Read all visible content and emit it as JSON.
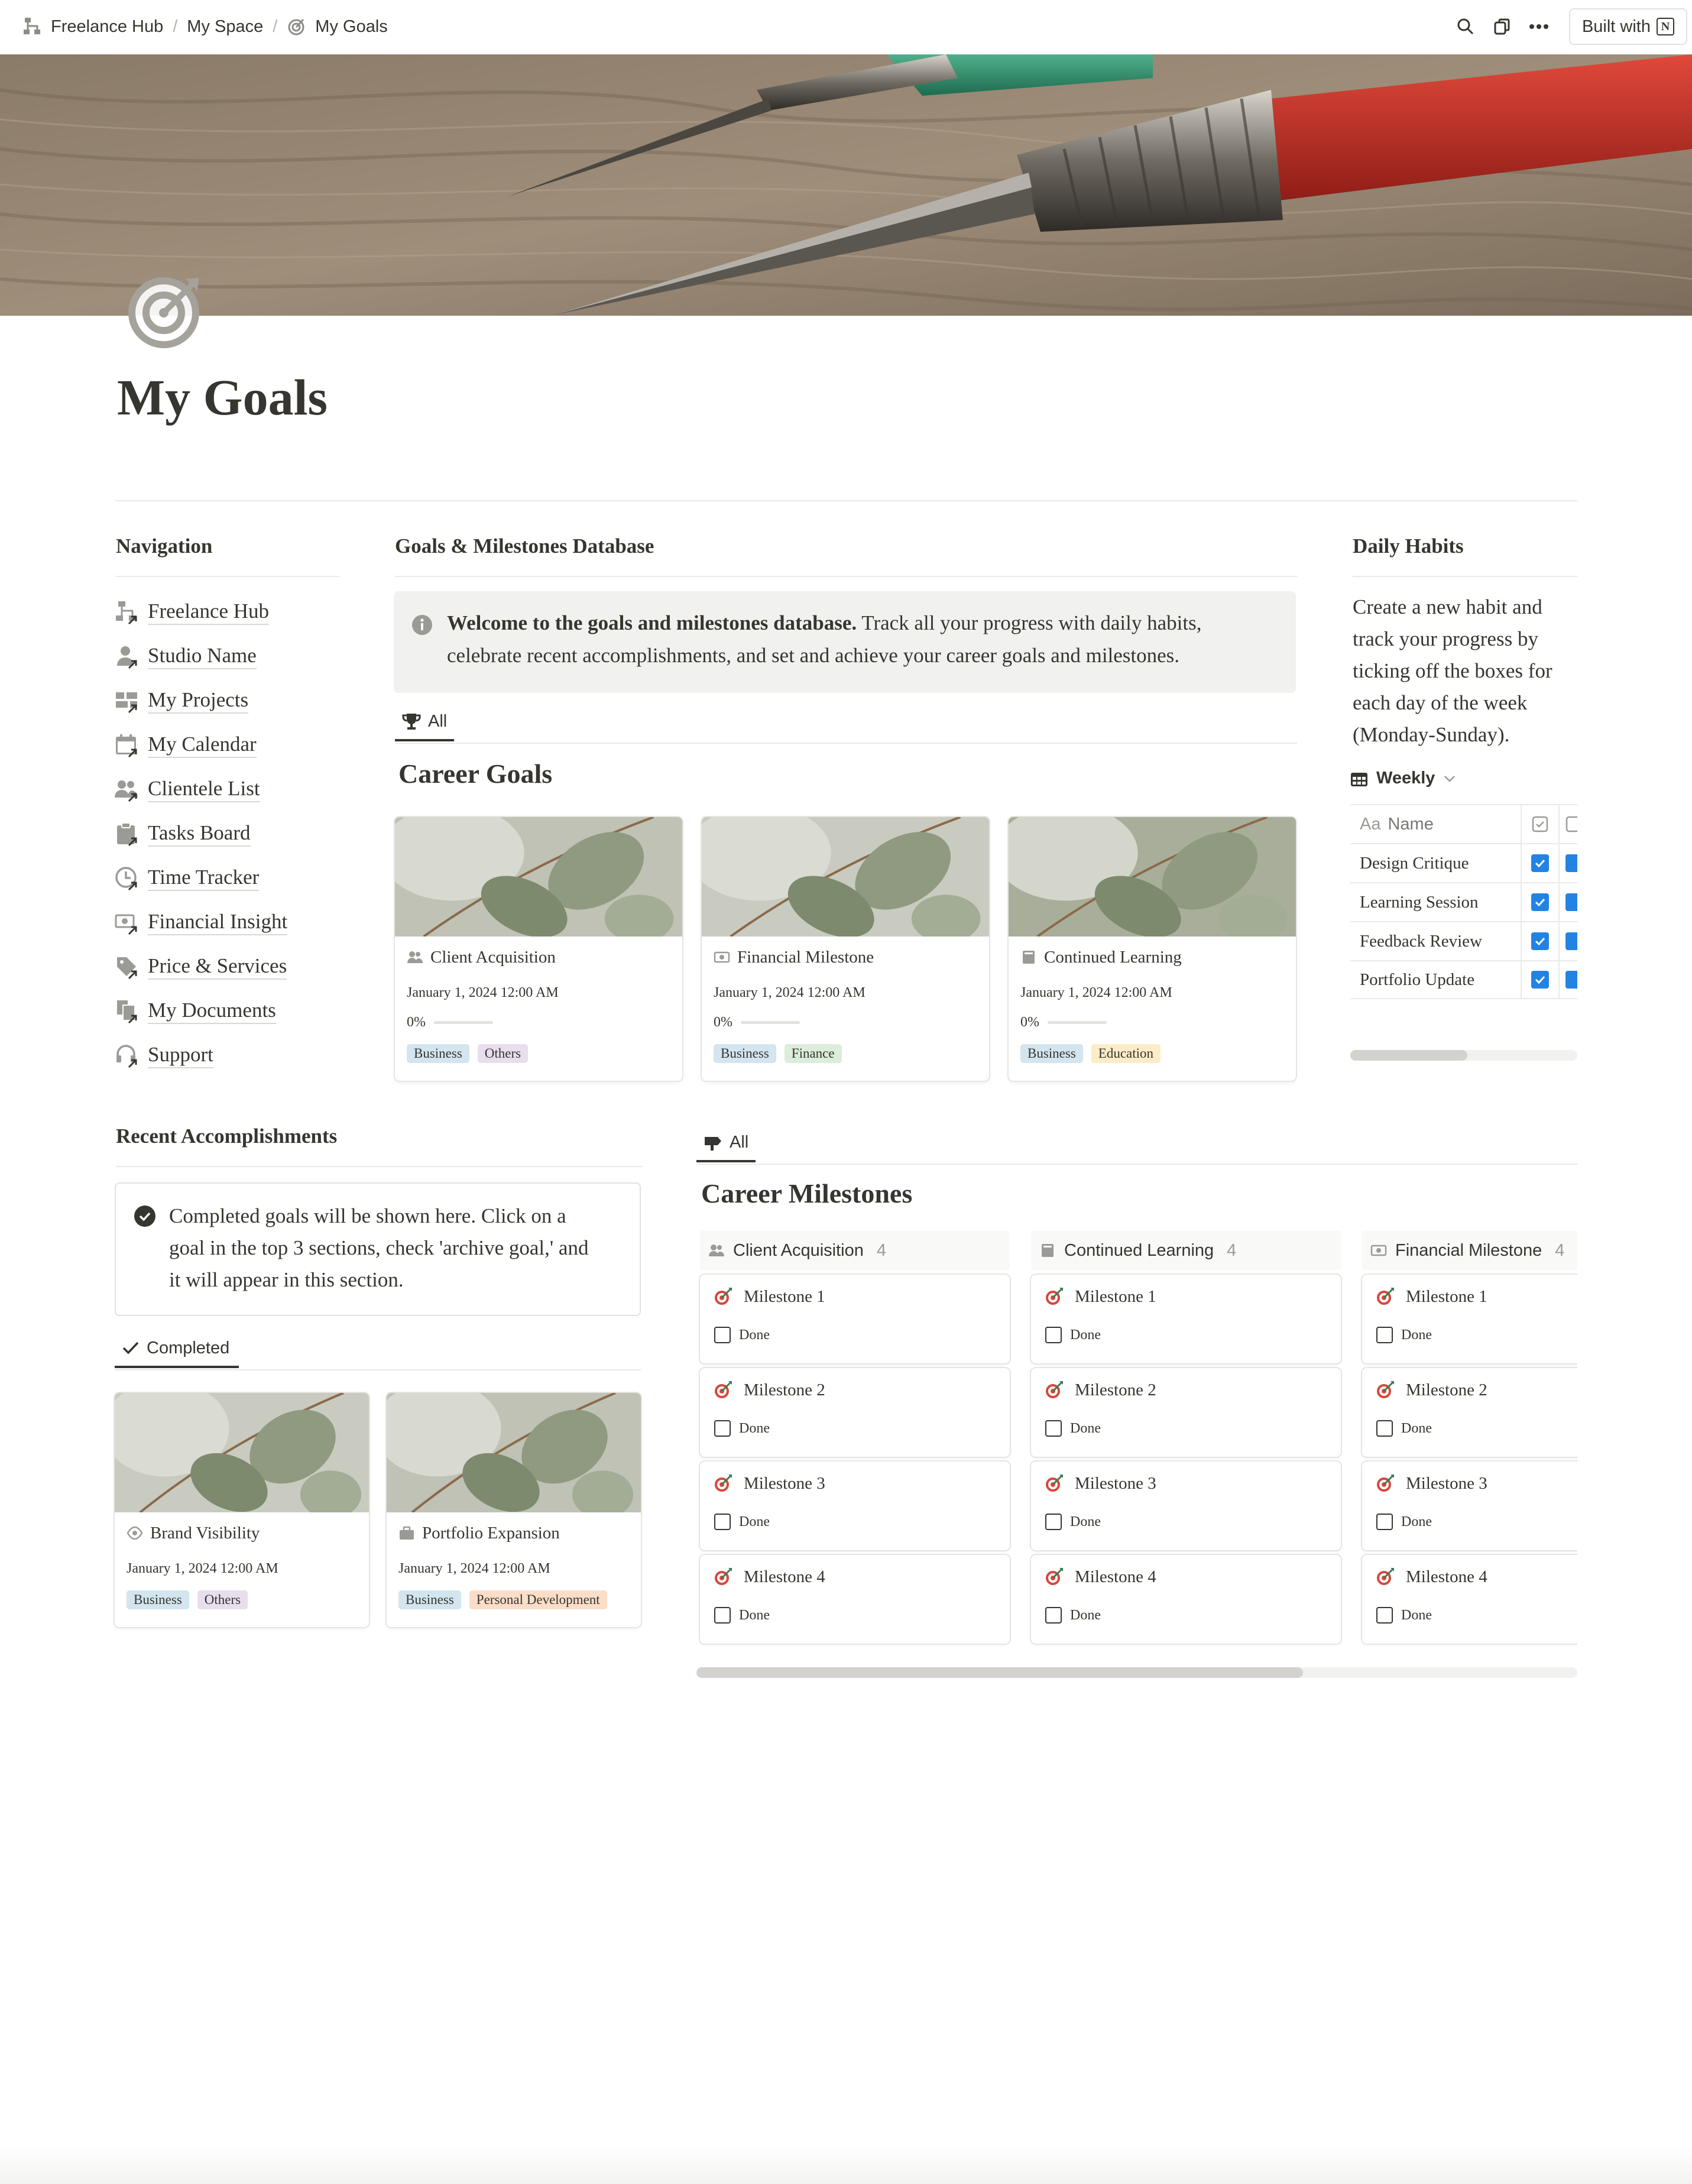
{
  "breadcrumb": [
    "Freelance Hub",
    "My Space",
    "My Goals"
  ],
  "topbar": {
    "built_with": "Built with"
  },
  "page": {
    "title": "My Goals"
  },
  "navigation": {
    "heading": "Navigation",
    "items": [
      {
        "label": "Freelance Hub",
        "icon": "org-chart-icon"
      },
      {
        "label": "Studio Name",
        "icon": "person-icon"
      },
      {
        "label": "My Projects",
        "icon": "grid-icon"
      },
      {
        "label": "My Calendar",
        "icon": "calendar-icon"
      },
      {
        "label": "Clientele List",
        "icon": "people-icon"
      },
      {
        "label": "Tasks Board",
        "icon": "clipboard-icon"
      },
      {
        "label": "Time Tracker",
        "icon": "clock-icon"
      },
      {
        "label": "Financial Insight",
        "icon": "money-search-icon"
      },
      {
        "label": "Price & Services",
        "icon": "price-tag-icon"
      },
      {
        "label": "My Documents",
        "icon": "documents-icon"
      },
      {
        "label": "Support",
        "icon": "headset-icon"
      }
    ]
  },
  "goals_db": {
    "heading": "Goals & Milestones Database",
    "callout_bold": "Welcome to the goals and milestones database.",
    "callout_text": " Track all your progress with daily habits, celebrate recent accomplishments, and set and achieve your career goals and milestones.",
    "tab": "All",
    "title": "Career Goals",
    "cards": [
      {
        "title": "Client Acquisition",
        "date": "January 1, 2024 12:00 AM",
        "progress": "0%",
        "tags": [
          {
            "label": "Business",
            "color": "#d3e5ef"
          },
          {
            "label": "Others",
            "color": "#e8deee"
          }
        ]
      },
      {
        "title": "Financial Milestone",
        "date": "January 1, 2024 12:00 AM",
        "progress": "0%",
        "tags": [
          {
            "label": "Business",
            "color": "#d3e5ef"
          },
          {
            "label": "Finance",
            "color": "#dbeddb"
          }
        ]
      },
      {
        "title": "Continued Learning",
        "date": "January 1, 2024 12:00 AM",
        "progress": "0%",
        "tags": [
          {
            "label": "Business",
            "color": "#d3e5ef"
          },
          {
            "label": "Education",
            "color": "#fdecc8"
          }
        ]
      }
    ]
  },
  "habits": {
    "heading": "Daily Habits",
    "description": "Create a new habit and track your progress by ticking off the boxes for each day of the week (Monday-Sunday).",
    "view": "Weekly",
    "name_header": "Name",
    "name_prefix": "Aa",
    "rows": [
      "Design Critique",
      "Learning Session",
      "Feedback Review",
      "Portfolio Update"
    ]
  },
  "accomplishments": {
    "heading": "Recent Accomplishments",
    "note": "Completed goals will be shown here. Click on a goal in the top 3 sections, check 'archive goal,' and it will appear in this section.",
    "tab": "Completed",
    "cards": [
      {
        "title": "Brand Visibility",
        "date": "January 1, 2024 12:00 AM",
        "tags": [
          {
            "label": "Business",
            "color": "#d3e5ef"
          },
          {
            "label": "Others",
            "color": "#e8deee"
          }
        ]
      },
      {
        "title": "Portfolio Expansion",
        "date": "January 1, 2024 12:00 AM",
        "tags": [
          {
            "label": "Business",
            "color": "#d3e5ef"
          },
          {
            "label": "Personal Development",
            "color": "#fadec9"
          }
        ]
      }
    ]
  },
  "milestones": {
    "tab": "All",
    "title": "Career Milestones",
    "columns": [
      {
        "name": "Client Acquisition",
        "count": "4"
      },
      {
        "name": "Continued Learning",
        "count": "4"
      },
      {
        "name": "Financial Milestone",
        "count": "4"
      }
    ],
    "items": [
      "Milestone 1",
      "Milestone 2",
      "Milestone 3",
      "Milestone 4"
    ],
    "done_label": "Done"
  },
  "colors": {
    "accent": "#2383e2",
    "text": "#37352f"
  }
}
